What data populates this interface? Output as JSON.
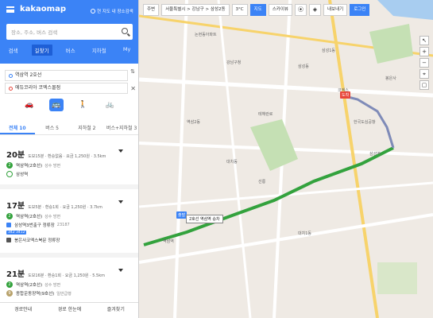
{
  "sidebar": {
    "logo": "kakaomap",
    "checkbox_label": "현 지도 내 장소검색",
    "search_placeholder": "장소, 주소, 버스 검색",
    "tabs": [
      "검색",
      "길찾기",
      "버스",
      "지하철",
      "My"
    ],
    "from": "역삼역 2호선",
    "to": "에듀코리아 코엑스몰점",
    "route_tabs": [
      "전체 10",
      "버스 5",
      "지하철 2",
      "버스+지하철 3"
    ],
    "routes": [
      {
        "time": "20분",
        "meta": "도보15분 · 환승없음 · 요금 1,250원 · 3.5km",
        "steps": [
          {
            "badge": "2",
            "text": "역삼역(2호선)",
            "sub": "성수 방면"
          },
          {
            "badge": "",
            "text": "삼성역",
            "sub": ""
          }
        ]
      },
      {
        "time": "17분",
        "meta": "도보5분 · 환승1회 · 요금 1,250원 · 3.7km",
        "steps": [
          {
            "badge": "2",
            "text": "역삼역(2호선)",
            "sub": "성수 방면"
          },
          {
            "badge": "",
            "text": "삼성역3번출구 정류장",
            "sub": "23187"
          },
          {
            "badge": "",
            "text": "342  3412",
            "sub": ""
          },
          {
            "badge": "",
            "text": "봉은사코엑스북문 정류장",
            "sub": ""
          }
        ]
      },
      {
        "time": "21분",
        "meta": "도보16분 · 환승1회 · 요금 1,250원 · 5.5km",
        "steps": [
          {
            "badge": "2",
            "text": "역삼역(2호선)",
            "sub": "성수 방면"
          },
          {
            "badge": "9",
            "text": "종합운동장역(9호선)",
            "sub": "일반급행"
          }
        ]
      }
    ],
    "footer": [
      "경로안내",
      "경로 한눈에",
      "즐겨찾기"
    ]
  },
  "map": {
    "toolbar": [
      "주변",
      "서울특별시",
      "강남구",
      "삼성2동",
      "3°C",
      "지도",
      "스카이뷰",
      "",
      "",
      "내보내기",
      "로그인"
    ],
    "tooltip": "2호선 역삼역 승차",
    "labels": [
      "논현동아파트",
      "강남구청",
      "삼성동",
      "대치동",
      "역삼2동",
      "선릉",
      "삼성역",
      "한국도심공항",
      "코엑스",
      "삼성1동",
      "역삼역",
      "봉은사",
      "대치1동",
      "테헤란로"
    ],
    "start_marker": "출발",
    "end_marker": "도착"
  }
}
